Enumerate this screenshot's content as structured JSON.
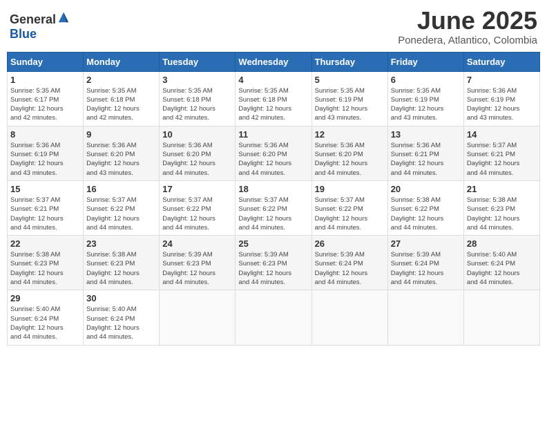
{
  "header": {
    "logo_general": "General",
    "logo_blue": "Blue",
    "month_title": "June 2025",
    "location": "Ponedera, Atlantico, Colombia"
  },
  "days_of_week": [
    "Sunday",
    "Monday",
    "Tuesday",
    "Wednesday",
    "Thursday",
    "Friday",
    "Saturday"
  ],
  "weeks": [
    [
      {
        "day": "1",
        "sunrise": "5:35 AM",
        "sunset": "6:17 PM",
        "daylight": "12 hours and 42 minutes."
      },
      {
        "day": "2",
        "sunrise": "5:35 AM",
        "sunset": "6:18 PM",
        "daylight": "12 hours and 42 minutes."
      },
      {
        "day": "3",
        "sunrise": "5:35 AM",
        "sunset": "6:18 PM",
        "daylight": "12 hours and 42 minutes."
      },
      {
        "day": "4",
        "sunrise": "5:35 AM",
        "sunset": "6:18 PM",
        "daylight": "12 hours and 42 minutes."
      },
      {
        "day": "5",
        "sunrise": "5:35 AM",
        "sunset": "6:19 PM",
        "daylight": "12 hours and 43 minutes."
      },
      {
        "day": "6",
        "sunrise": "5:35 AM",
        "sunset": "6:19 PM",
        "daylight": "12 hours and 43 minutes."
      },
      {
        "day": "7",
        "sunrise": "5:36 AM",
        "sunset": "6:19 PM",
        "daylight": "12 hours and 43 minutes."
      }
    ],
    [
      {
        "day": "8",
        "sunrise": "5:36 AM",
        "sunset": "6:19 PM",
        "daylight": "12 hours and 43 minutes."
      },
      {
        "day": "9",
        "sunrise": "5:36 AM",
        "sunset": "6:20 PM",
        "daylight": "12 hours and 43 minutes."
      },
      {
        "day": "10",
        "sunrise": "5:36 AM",
        "sunset": "6:20 PM",
        "daylight": "12 hours and 44 minutes."
      },
      {
        "day": "11",
        "sunrise": "5:36 AM",
        "sunset": "6:20 PM",
        "daylight": "12 hours and 44 minutes."
      },
      {
        "day": "12",
        "sunrise": "5:36 AM",
        "sunset": "6:20 PM",
        "daylight": "12 hours and 44 minutes."
      },
      {
        "day": "13",
        "sunrise": "5:36 AM",
        "sunset": "6:21 PM",
        "daylight": "12 hours and 44 minutes."
      },
      {
        "day": "14",
        "sunrise": "5:37 AM",
        "sunset": "6:21 PM",
        "daylight": "12 hours and 44 minutes."
      }
    ],
    [
      {
        "day": "15",
        "sunrise": "5:37 AM",
        "sunset": "6:21 PM",
        "daylight": "12 hours and 44 minutes."
      },
      {
        "day": "16",
        "sunrise": "5:37 AM",
        "sunset": "6:22 PM",
        "daylight": "12 hours and 44 minutes."
      },
      {
        "day": "17",
        "sunrise": "5:37 AM",
        "sunset": "6:22 PM",
        "daylight": "12 hours and 44 minutes."
      },
      {
        "day": "18",
        "sunrise": "5:37 AM",
        "sunset": "6:22 PM",
        "daylight": "12 hours and 44 minutes."
      },
      {
        "day": "19",
        "sunrise": "5:37 AM",
        "sunset": "6:22 PM",
        "daylight": "12 hours and 44 minutes."
      },
      {
        "day": "20",
        "sunrise": "5:38 AM",
        "sunset": "6:22 PM",
        "daylight": "12 hours and 44 minutes."
      },
      {
        "day": "21",
        "sunrise": "5:38 AM",
        "sunset": "6:23 PM",
        "daylight": "12 hours and 44 minutes."
      }
    ],
    [
      {
        "day": "22",
        "sunrise": "5:38 AM",
        "sunset": "6:23 PM",
        "daylight": "12 hours and 44 minutes."
      },
      {
        "day": "23",
        "sunrise": "5:38 AM",
        "sunset": "6:23 PM",
        "daylight": "12 hours and 44 minutes."
      },
      {
        "day": "24",
        "sunrise": "5:39 AM",
        "sunset": "6:23 PM",
        "daylight": "12 hours and 44 minutes."
      },
      {
        "day": "25",
        "sunrise": "5:39 AM",
        "sunset": "6:23 PM",
        "daylight": "12 hours and 44 minutes."
      },
      {
        "day": "26",
        "sunrise": "5:39 AM",
        "sunset": "6:24 PM",
        "daylight": "12 hours and 44 minutes."
      },
      {
        "day": "27",
        "sunrise": "5:39 AM",
        "sunset": "6:24 PM",
        "daylight": "12 hours and 44 minutes."
      },
      {
        "day": "28",
        "sunrise": "5:40 AM",
        "sunset": "6:24 PM",
        "daylight": "12 hours and 44 minutes."
      }
    ],
    [
      {
        "day": "29",
        "sunrise": "5:40 AM",
        "sunset": "6:24 PM",
        "daylight": "12 hours and 44 minutes."
      },
      {
        "day": "30",
        "sunrise": "5:40 AM",
        "sunset": "6:24 PM",
        "daylight": "12 hours and 44 minutes."
      },
      null,
      null,
      null,
      null,
      null
    ]
  ],
  "labels": {
    "sunrise_prefix": "Sunrise: ",
    "sunset_prefix": "Sunset: ",
    "daylight_prefix": "Daylight: "
  }
}
